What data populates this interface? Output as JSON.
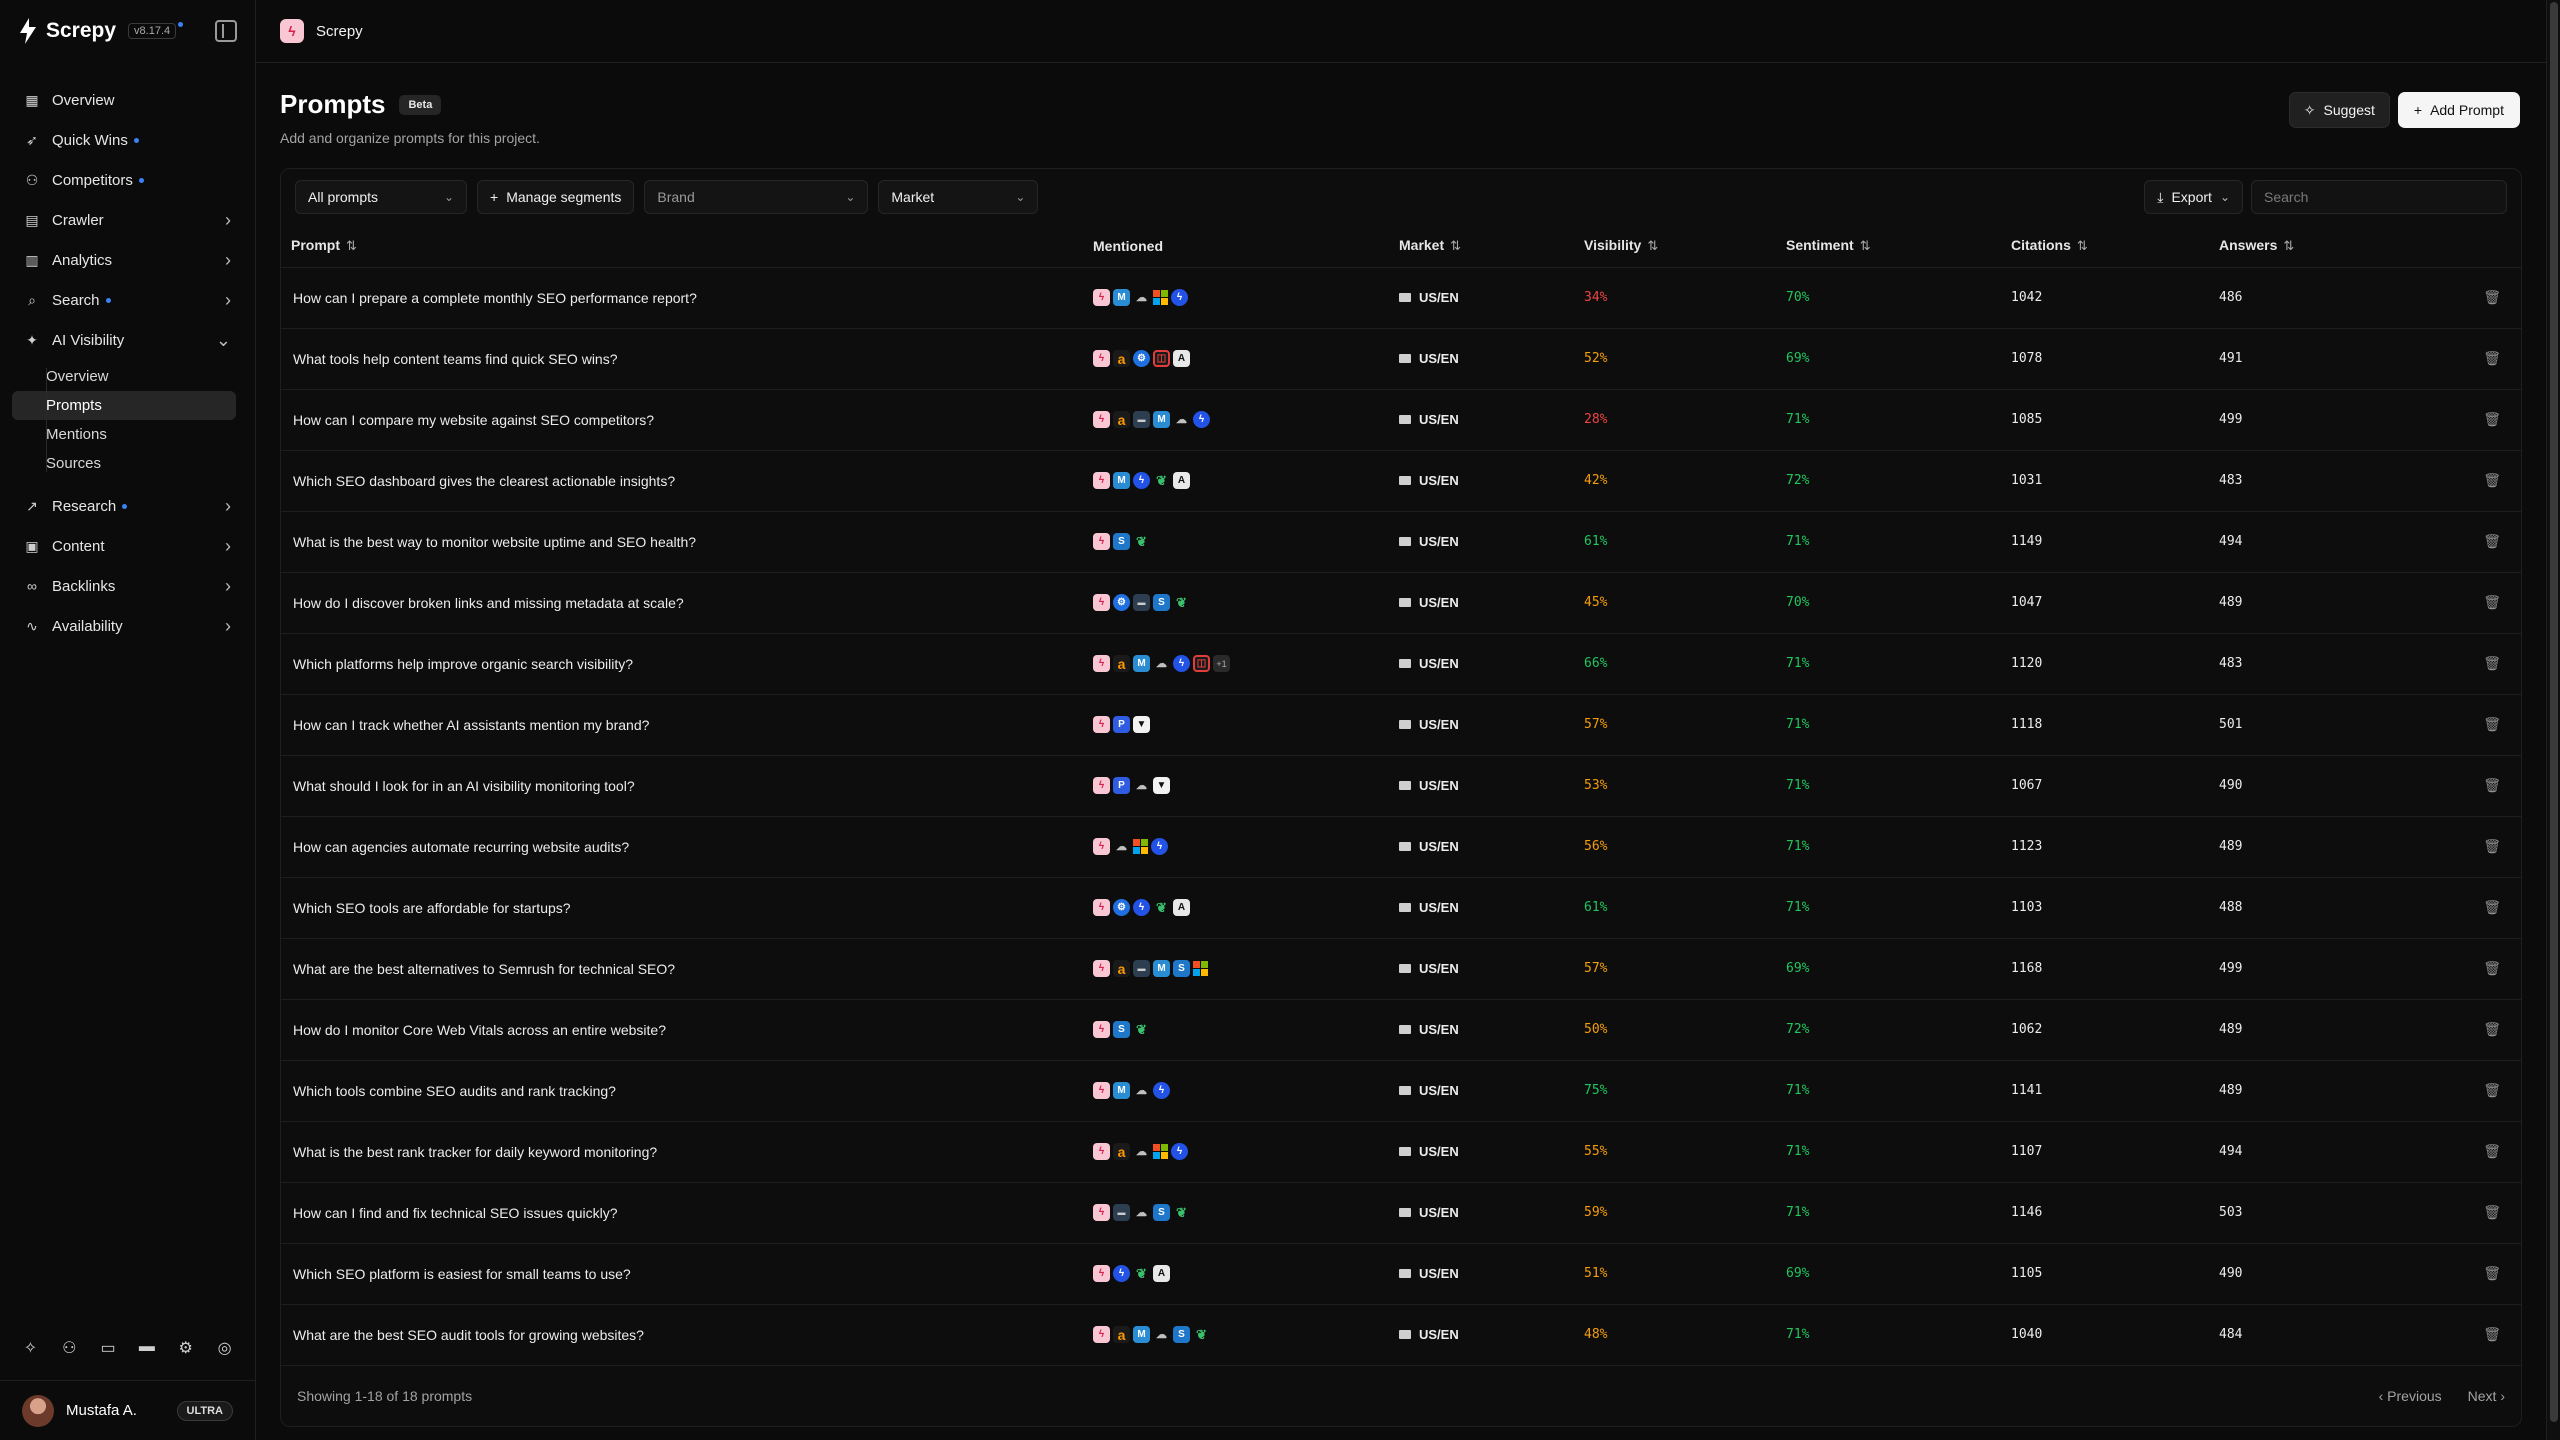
{
  "sidebar": {
    "brand": "Screpy",
    "version": "v8.17.4",
    "items": [
      {
        "label": "Overview",
        "icon": "grid-icon"
      },
      {
        "label": "Quick Wins",
        "icon": "rocket-icon",
        "dot": true
      },
      {
        "label": "Competitors",
        "icon": "users-icon",
        "dot": true
      },
      {
        "label": "Crawler",
        "icon": "document-icon",
        "chevron": true
      },
      {
        "label": "Analytics",
        "icon": "bar-chart-icon",
        "chevron": true
      },
      {
        "label": "Search",
        "icon": "search-icon",
        "dot": true,
        "chevron": true
      },
      {
        "label": "AI Visibility",
        "icon": "sparkle-icon",
        "chevron": true,
        "expanded": true
      },
      {
        "label": "Research",
        "icon": "trend-icon",
        "dot": true,
        "chevron": true
      },
      {
        "label": "Content",
        "icon": "book-icon",
        "chevron": true
      },
      {
        "label": "Backlinks",
        "icon": "link-icon",
        "chevron": true
      },
      {
        "label": "Availability",
        "icon": "pulse-icon",
        "chevron": true
      }
    ],
    "ai_visibility_sub": [
      "Overview",
      "Prompts",
      "Mentions",
      "Sources"
    ],
    "user": {
      "name": "Mustafa A.",
      "plan": "ULTRA"
    }
  },
  "topbar": {
    "project": "Screpy"
  },
  "page": {
    "title": "Prompts",
    "badge": "Beta",
    "subtitle": "Add and organize prompts for this project.",
    "suggest_label": "Suggest",
    "add_label": "Add Prompt"
  },
  "filters": {
    "segment": "All prompts",
    "manage": "Manage segments",
    "brand": "Brand",
    "market": "Market",
    "export": "Export",
    "search_placeholder": "Search"
  },
  "table": {
    "headers": [
      "Prompt",
      "Mentioned",
      "Market",
      "Visibility",
      "Sentiment",
      "Citations",
      "Answers"
    ],
    "rows": [
      {
        "prompt": "How can I prepare a complete monthly SEO performance report?",
        "mentions": [
          "screpy",
          "mz",
          "cloud",
          "ms",
          "bolt"
        ],
        "market": "US/EN",
        "visibility": "34%",
        "vis_level": "red",
        "sentiment": "70%",
        "citations": "1042",
        "answers": "486"
      },
      {
        "prompt": "What tools help content teams find quick SEO wins?",
        "mentions": [
          "screpy",
          "amz",
          "gear",
          "red",
          "mono"
        ],
        "market": "US/EN",
        "visibility": "52%",
        "vis_level": "orange",
        "sentiment": "69%",
        "citations": "1078",
        "answers": "491"
      },
      {
        "prompt": "How can I compare my website against SEO competitors?",
        "mentions": [
          "screpy",
          "amz",
          "semrush",
          "mz",
          "cloud",
          "bolt"
        ],
        "market": "US/EN",
        "visibility": "28%",
        "vis_level": "red",
        "sentiment": "71%",
        "citations": "1085",
        "answers": "499"
      },
      {
        "prompt": "Which SEO dashboard gives the clearest actionable insights?",
        "mentions": [
          "screpy",
          "mz",
          "bolt",
          "leaf",
          "mono"
        ],
        "market": "US/EN",
        "visibility": "42%",
        "vis_level": "orange",
        "sentiment": "72%",
        "citations": "1031",
        "answers": "483"
      },
      {
        "prompt": "What is the best way to monitor website uptime and SEO health?",
        "mentions": [
          "screpy",
          "s",
          "leaf"
        ],
        "market": "US/EN",
        "visibility": "61%",
        "vis_level": "green",
        "sentiment": "71%",
        "citations": "1149",
        "answers": "494"
      },
      {
        "prompt": "How do I discover broken links and missing metadata at scale?",
        "mentions": [
          "screpy",
          "gear",
          "semrush",
          "s",
          "leaf"
        ],
        "market": "US/EN",
        "visibility": "45%",
        "vis_level": "orange",
        "sentiment": "70%",
        "citations": "1047",
        "answers": "489"
      },
      {
        "prompt": "Which platforms help improve organic search visibility?",
        "mentions": [
          "screpy",
          "amz",
          "mz",
          "cloud",
          "bolt",
          "red",
          "plus"
        ],
        "market": "US/EN",
        "visibility": "66%",
        "vis_level": "green",
        "sentiment": "71%",
        "citations": "1120",
        "answers": "483"
      },
      {
        "prompt": "How can I track whether AI assistants mention my brand?",
        "mentions": [
          "screpy",
          "p",
          "shield"
        ],
        "market": "US/EN",
        "visibility": "57%",
        "vis_level": "orange",
        "sentiment": "71%",
        "citations": "1118",
        "answers": "501"
      },
      {
        "prompt": "What should I look for in an AI visibility monitoring tool?",
        "mentions": [
          "screpy",
          "p",
          "cloud",
          "shield"
        ],
        "market": "US/EN",
        "visibility": "53%",
        "vis_level": "orange",
        "sentiment": "71%",
        "citations": "1067",
        "answers": "490"
      },
      {
        "prompt": "How can agencies automate recurring website audits?",
        "mentions": [
          "screpy",
          "cloud",
          "ms",
          "bolt"
        ],
        "market": "US/EN",
        "visibility": "56%",
        "vis_level": "orange",
        "sentiment": "71%",
        "citations": "1123",
        "answers": "489"
      },
      {
        "prompt": "Which SEO tools are affordable for startups?",
        "mentions": [
          "screpy",
          "gear",
          "bolt",
          "leaf",
          "mono"
        ],
        "market": "US/EN",
        "visibility": "61%",
        "vis_level": "green",
        "sentiment": "71%",
        "citations": "1103",
        "answers": "488"
      },
      {
        "prompt": "What are the best alternatives to Semrush for technical SEO?",
        "mentions": [
          "screpy",
          "amz",
          "semrush",
          "mz",
          "s",
          "ms"
        ],
        "market": "US/EN",
        "visibility": "57%",
        "vis_level": "orange",
        "sentiment": "69%",
        "citations": "1168",
        "answers": "499"
      },
      {
        "prompt": "How do I monitor Core Web Vitals across an entire website?",
        "mentions": [
          "screpy",
          "s",
          "leaf"
        ],
        "market": "US/EN",
        "visibility": "50%",
        "vis_level": "orange",
        "sentiment": "72%",
        "citations": "1062",
        "answers": "489"
      },
      {
        "prompt": "Which tools combine SEO audits and rank tracking?",
        "mentions": [
          "screpy",
          "mz",
          "cloud",
          "bolt"
        ],
        "market": "US/EN",
        "visibility": "75%",
        "vis_level": "green",
        "sentiment": "71%",
        "citations": "1141",
        "answers": "489"
      },
      {
        "prompt": "What is the best rank tracker for daily keyword monitoring?",
        "mentions": [
          "screpy",
          "amz",
          "cloud",
          "ms",
          "bolt"
        ],
        "market": "US/EN",
        "visibility": "55%",
        "vis_level": "orange",
        "sentiment": "71%",
        "citations": "1107",
        "answers": "494"
      },
      {
        "prompt": "How can I find and fix technical SEO issues quickly?",
        "mentions": [
          "screpy",
          "semrush",
          "cloud",
          "s",
          "leaf"
        ],
        "market": "US/EN",
        "visibility": "59%",
        "vis_level": "orange",
        "sentiment": "71%",
        "citations": "1146",
        "answers": "503"
      },
      {
        "prompt": "Which SEO platform is easiest for small teams to use?",
        "mentions": [
          "screpy",
          "bolt",
          "leaf",
          "mono"
        ],
        "market": "US/EN",
        "visibility": "51%",
        "vis_level": "orange",
        "sentiment": "69%",
        "citations": "1105",
        "answers": "490"
      },
      {
        "prompt": "What are the best SEO audit tools for growing websites?",
        "mentions": [
          "screpy",
          "amz",
          "mz",
          "cloud",
          "s",
          "leaf"
        ],
        "market": "US/EN",
        "visibility": "48%",
        "vis_level": "orange",
        "sentiment": "71%",
        "citations": "1040",
        "answers": "484"
      }
    ]
  },
  "footer": {
    "showing": "Showing 1-18 of 18 prompts",
    "previous": "Previous",
    "next": "Next"
  },
  "colors": {
    "accent": "#3b82f6",
    "red": "#ef4444",
    "orange": "#f59e0b",
    "green": "#22c55e"
  }
}
